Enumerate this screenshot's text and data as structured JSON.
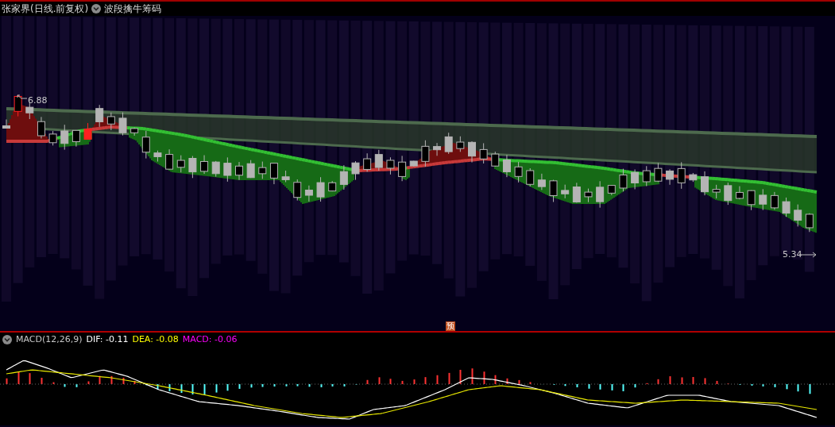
{
  "header": {
    "title": "张家界(日线.前复权)",
    "indicator": "波段擒牛筹码"
  },
  "price_chart": {
    "high_label": "6.88",
    "low_label": "5.34",
    "forecast_badge": "预"
  },
  "macd": {
    "name": "MACD(12,26,9)",
    "dif": "DIF: -0.11",
    "dea": "DEA: -0.08",
    "macd": "MACD: -0.06"
  }
}
